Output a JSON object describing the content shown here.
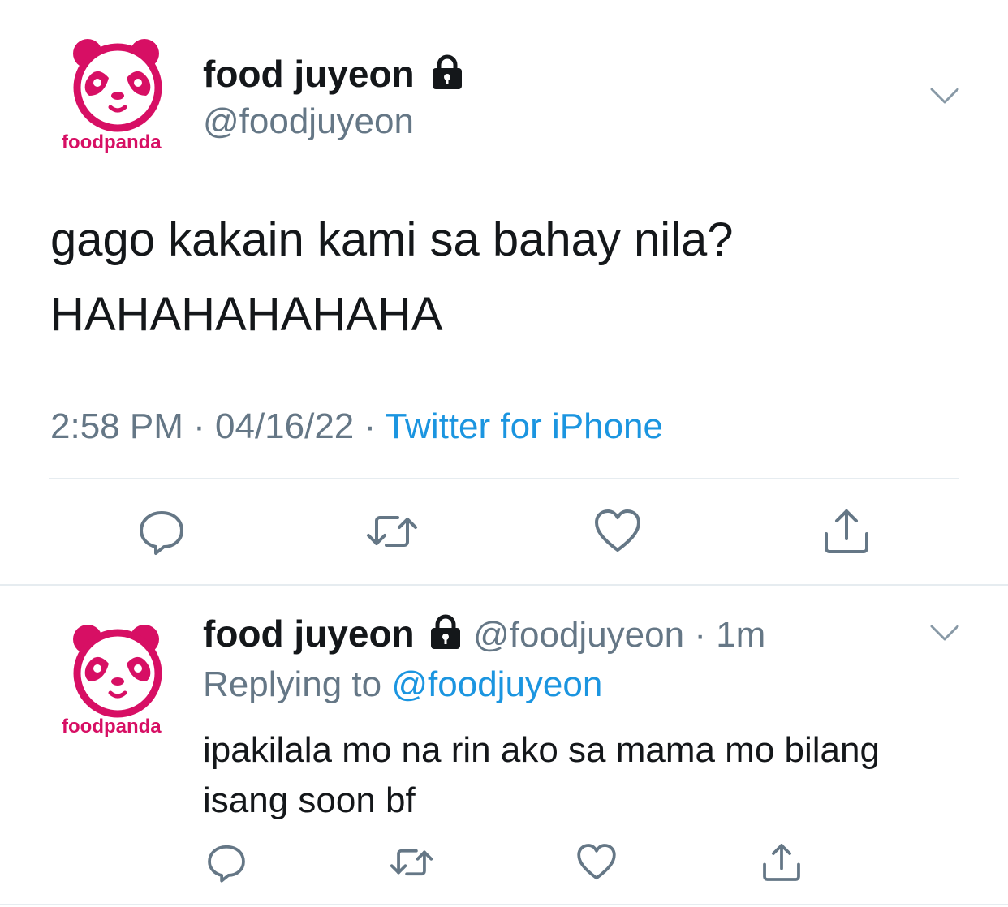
{
  "colors": {
    "brand": "#d70f64",
    "text": "#14171a",
    "secondary": "#657786",
    "link": "#1b95e0",
    "divider": "#e6ecf0"
  },
  "main_tweet": {
    "avatar_brand": "foodpanda",
    "display_name": "food juyeon",
    "lock_icon": "lock-icon",
    "handle": "@foodjuyeon",
    "text_line1": "gago kakain kami sa bahay nila?",
    "text_line2": "HAHAHAHAHAHA",
    "time": "2:58 PM",
    "date": "04/16/22",
    "separator": "·",
    "source": "Twitter for iPhone"
  },
  "reply_tweet": {
    "avatar_brand": "foodpanda",
    "display_name": "food juyeon",
    "handle": "@foodjuyeon",
    "separator": "·",
    "age": "1m",
    "replying_label": "Replying to",
    "replying_handle": "@foodjuyeon",
    "text_line1": "ipakilala mo na rin ako sa mama mo bilang",
    "text_line2": "isang soon bf"
  },
  "actions": [
    "reply-icon",
    "retweet-icon",
    "like-icon",
    "share-icon"
  ]
}
